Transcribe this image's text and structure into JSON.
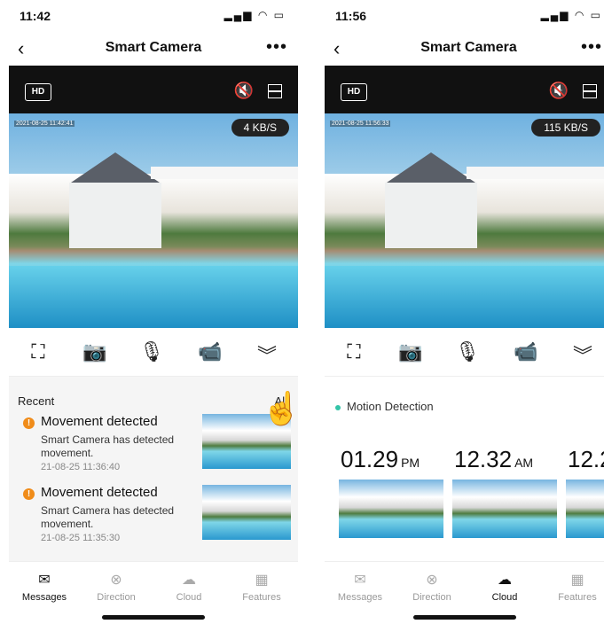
{
  "left": {
    "status_time": "11:42",
    "status_icons": "▂▄▆ ◠ ▭",
    "nav_title": "Smart Camera",
    "hd_label": "HD",
    "timestamp": "2021-08-25 11:42:41",
    "speed": "4 KB/S",
    "recent_label": "Recent",
    "all_label": "All",
    "alerts": [
      {
        "title": "Movement detected",
        "desc": "Smart Camera has detected movement.",
        "time": "21-08-25 11:36:40"
      },
      {
        "title": "Movement detected",
        "desc": "Smart Camera has detected movement.",
        "time": "21-08-25 11:35:30"
      }
    ],
    "tabs": [
      "Messages",
      "Direction",
      "Cloud",
      "Features"
    ]
  },
  "right": {
    "status_time": "11:56",
    "status_icons": "▂▄▆ ◠ ▭",
    "nav_title": "Smart Camera",
    "hd_label": "HD",
    "timestamp": "2021-08-25 11:56:33",
    "speed": "115 KB/S",
    "motion_label": "Motion Detection",
    "clips": [
      {
        "time": "01.29",
        "ampm": "PM"
      },
      {
        "time": "12.32",
        "ampm": "AM"
      },
      {
        "time": "12.2",
        "ampm": ""
      }
    ],
    "tabs": [
      "Messages",
      "Direction",
      "Cloud",
      "Features"
    ]
  },
  "icons": {
    "back": "‹",
    "more": "•••",
    "mute": "🔇",
    "screenshot": "⛶",
    "camera": "📷",
    "mic": "🎙",
    "record": "📹",
    "chevron": "︾",
    "messages": "✉",
    "direction": "⊗",
    "cloud": "☁",
    "features": "▦",
    "hand": "☝"
  },
  "colors": {
    "alert": "#f08c1a",
    "motion_dot": "#33c4a8",
    "hand": "#2fa7d8"
  }
}
